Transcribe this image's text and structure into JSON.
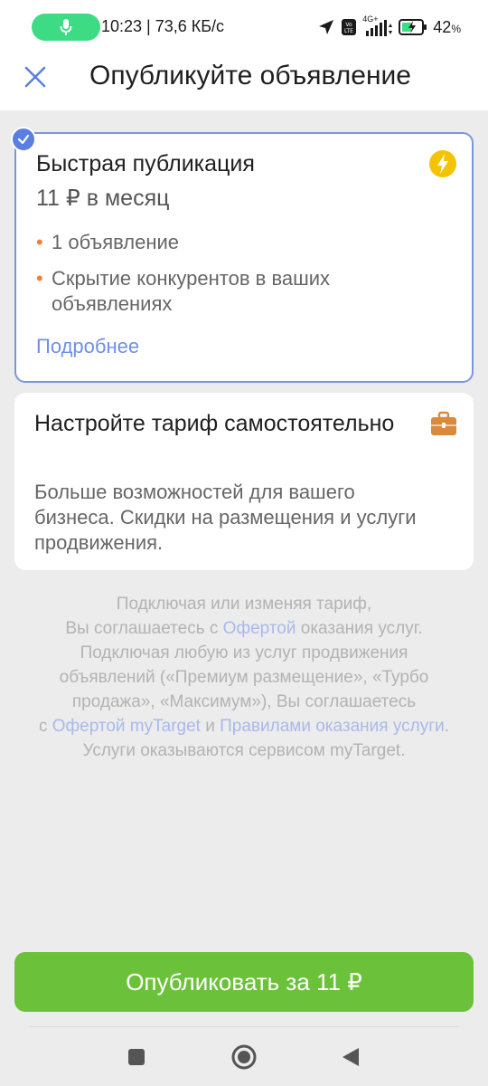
{
  "status_bar": {
    "time_speed": "10:23 | 73,6 КБ/с",
    "network": "4G+",
    "battery_percent": "42",
    "battery_unit": "%"
  },
  "header": {
    "title": "Опубликуйте объявление",
    "close_icon": "close-icon"
  },
  "plans": {
    "fast": {
      "title": "Быстрая публикация",
      "price": "11 ₽ в месяц",
      "features": [
        "1 объявление",
        "Скрытие конкурентов в ваших объявлениях"
      ],
      "more_link": "Подробнее",
      "selected": true,
      "icon": "lightning-icon",
      "icon_color": "#f5c400"
    },
    "custom": {
      "title": "Настройте тариф самостоятельно",
      "description": "Больше возможностей для вашего бизнеса. Скидки на размещения и услуги продвижения.",
      "icon": "briefcase-icon",
      "icon_color": "#d98a3c"
    }
  },
  "legal": {
    "p1": "Подключая или изменяя тариф,",
    "p2_pre": "Вы соглашаетесь с ",
    "p2_link": "Офертой",
    "p2_post": " оказания услуг.",
    "p3": "Подключая любую из услуг продвижения объявлений («Премиум размещение», «Турбо продажа», «Максимум»), Вы соглашаетесь",
    "p4_pre": "с ",
    "p4_link1": "Офертой myTarget",
    "p4_mid": " и ",
    "p4_link2": "Правилами оказания услуги",
    "p4_post": ". Услуги оказываются сервисом myTarget."
  },
  "publish_button": {
    "label": "Опубликовать за 11 ₽",
    "color": "#6cc13a"
  },
  "colors": {
    "accent": "#6f8fe6",
    "bullet": "#f0803c",
    "selected_border": "#7b96e0"
  }
}
